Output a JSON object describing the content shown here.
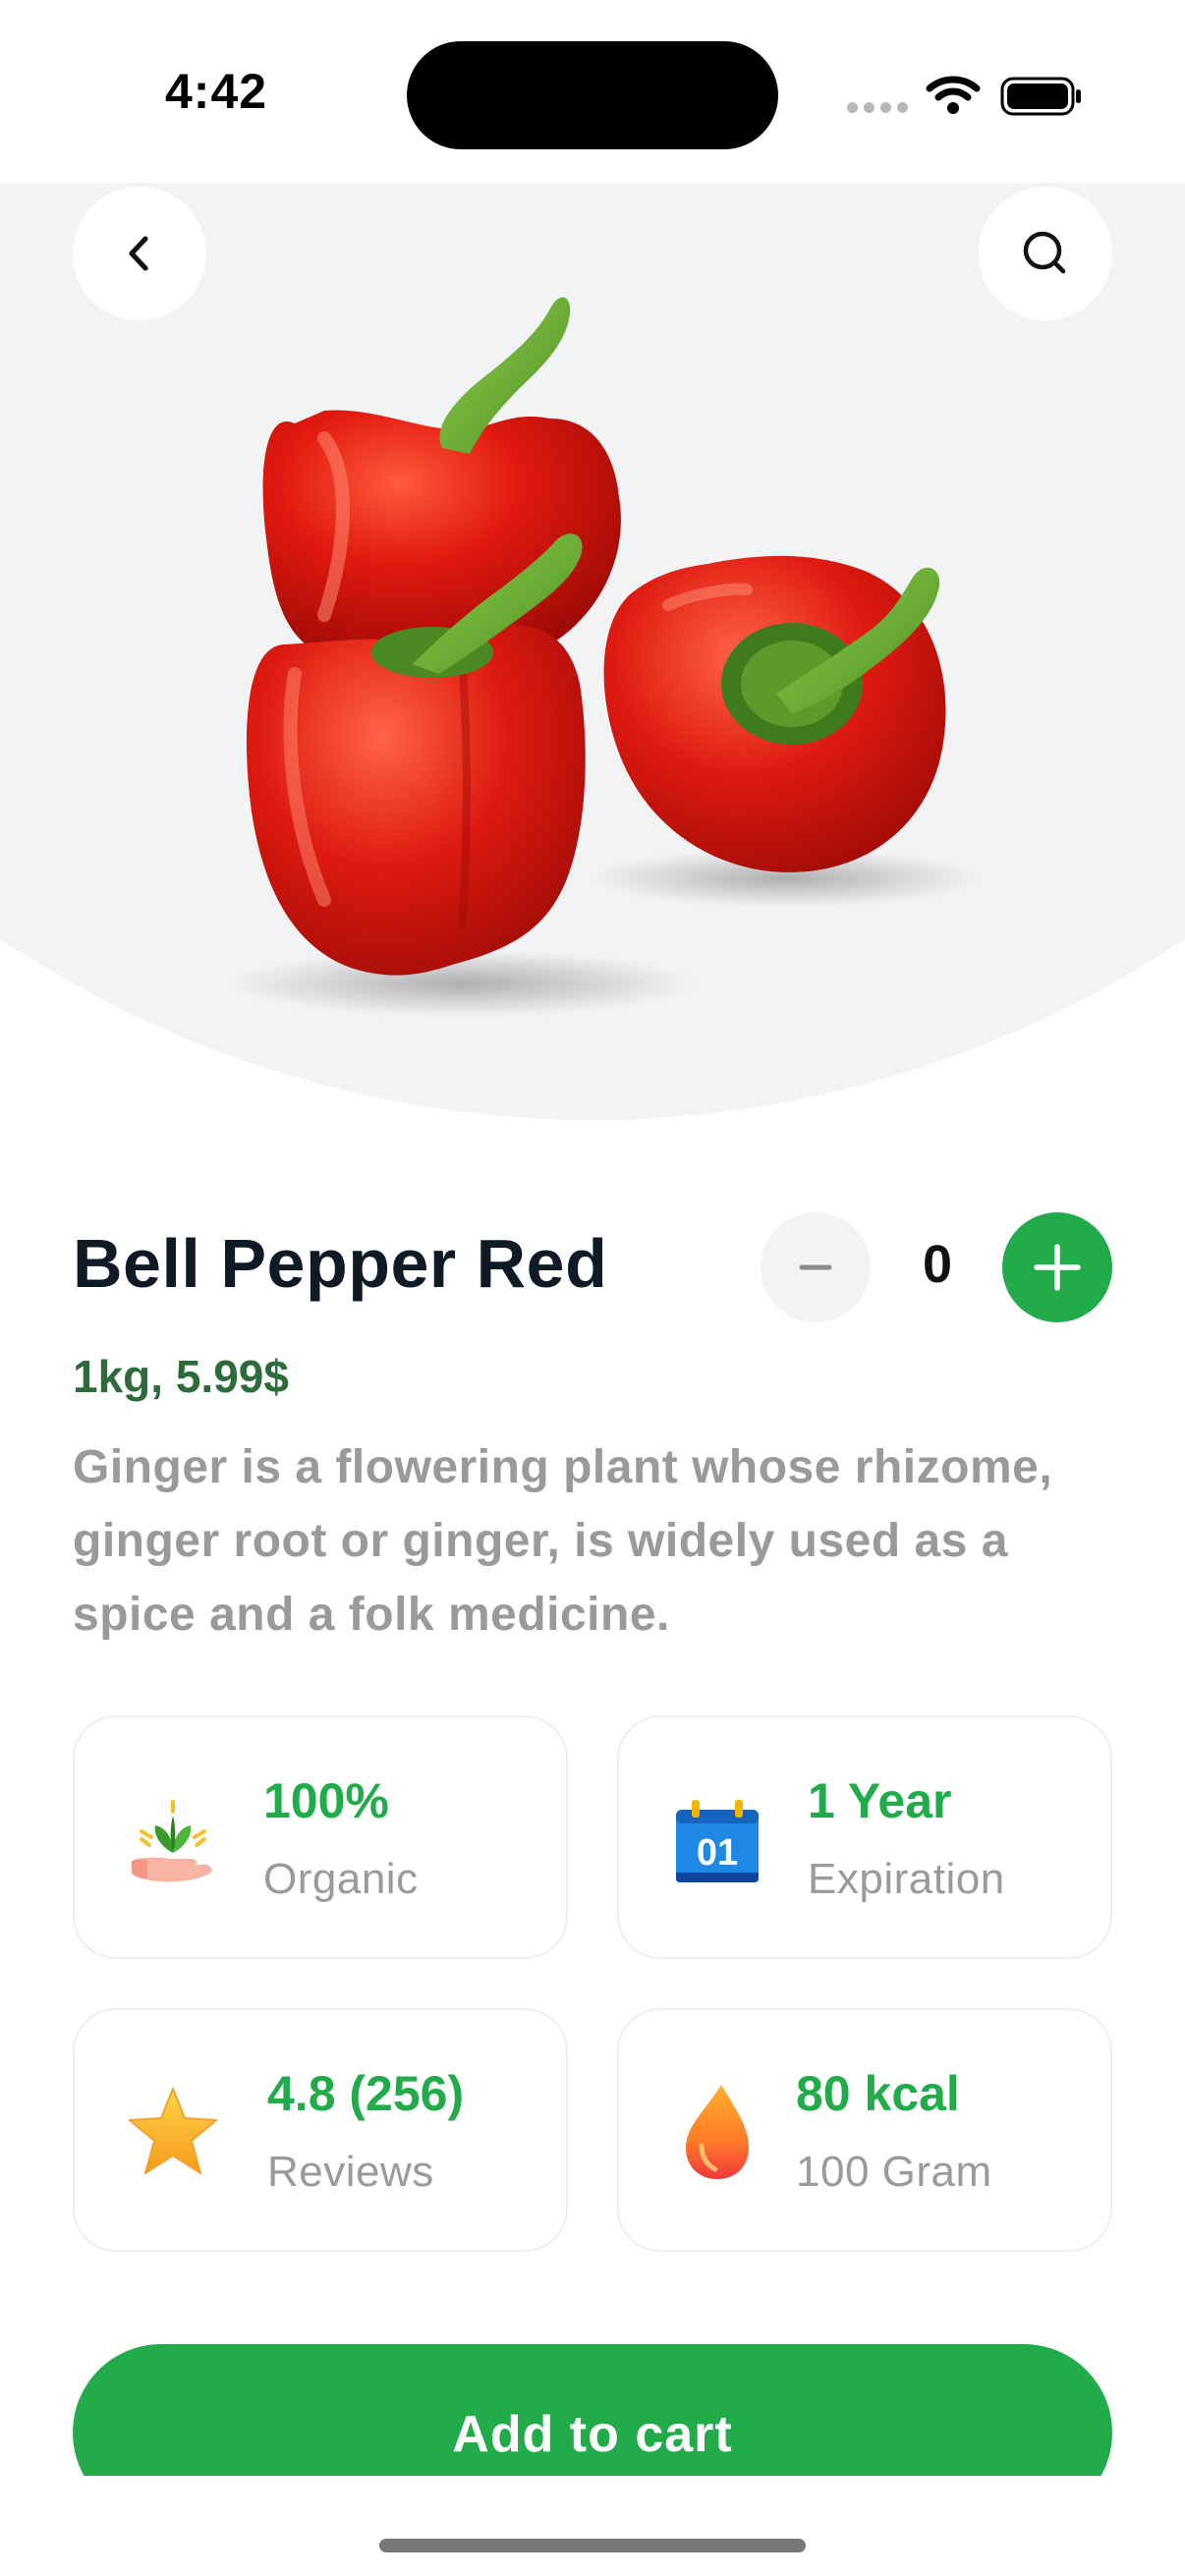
{
  "status_bar": {
    "time": "4:42"
  },
  "header": {
    "back_icon": "chevron-left-icon",
    "search_icon": "search-icon"
  },
  "product": {
    "name": "Bell Pepper Red",
    "price": "1kg, 5.99$",
    "description": "Ginger is a flowering plant whose rhizome, ginger root or ginger, is widely used as a spice and a folk medicine.",
    "quantity": "0",
    "image": "red-bell-peppers-image"
  },
  "info_cards": [
    {
      "value": "100%",
      "label": "Organic",
      "icon": "organic-leaf-hand-icon"
    },
    {
      "value": "1 Year",
      "label": "Expiration",
      "icon": "calendar-icon",
      "icon_text": "01"
    },
    {
      "value": "4.8 (256)",
      "label": "Reviews",
      "icon": "star-icon"
    },
    {
      "value": "80 kcal",
      "label": "100 Gram",
      "icon": "flame-drop-icon"
    }
  ],
  "actions": {
    "add_to_cart": "Add to cart"
  },
  "colors": {
    "accent": "#22ab4b",
    "price": "#2e6b3b",
    "title": "#0f1a24",
    "muted": "#9a9a9a",
    "hero_bg": "#f2f3f5"
  }
}
